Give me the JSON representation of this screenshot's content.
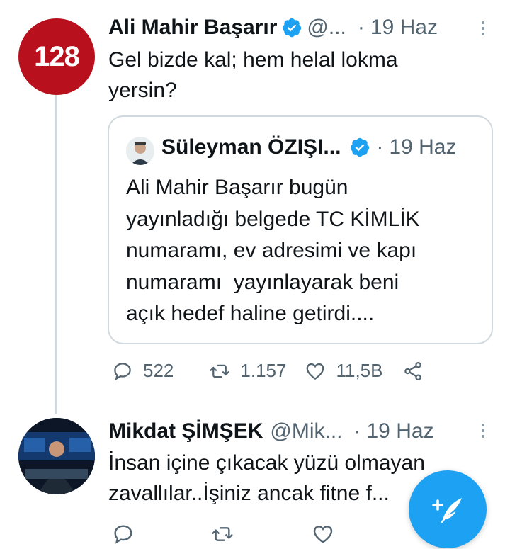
{
  "thread": [
    {
      "avatar_text": "128",
      "name": "Ali Mahir Başarır",
      "handle": "@...",
      "separator": "·",
      "date": "19 Haz",
      "text": "Gel bizde kal; hem helal lokma\nyersin?",
      "quoted": {
        "name": "Süleyman ÖZIŞI...",
        "separator": "·",
        "date": "19 Haz",
        "text": "Ali Mahir Başarır bugün\nyayınladığı belgede TC KİMLİK\nnumaramı, ev adresimi ve kapı\nnumaramı  yayınlayarak beni\naçık hedef haline getirdi...."
      },
      "stats": {
        "replies": "522",
        "retweets": "1.157",
        "likes": "11,5B"
      }
    },
    {
      "name": "Mikdat ŞİMŞEK",
      "handle": "@Mik...",
      "separator": "·",
      "date": "19 Haz",
      "text": "İnsan içine çıkacak yüzü olmayan\nzavallılar..İşiniz ancak fitne f..."
    }
  ],
  "colors": {
    "accent": "#1da1f2",
    "verified": "#1da1f2",
    "avatar_red": "#b8111d",
    "muted": "#536471"
  },
  "icons": [
    "verified-icon",
    "more-icon",
    "reply-icon",
    "retweet-icon",
    "like-icon",
    "share-icon",
    "compose-icon"
  ]
}
